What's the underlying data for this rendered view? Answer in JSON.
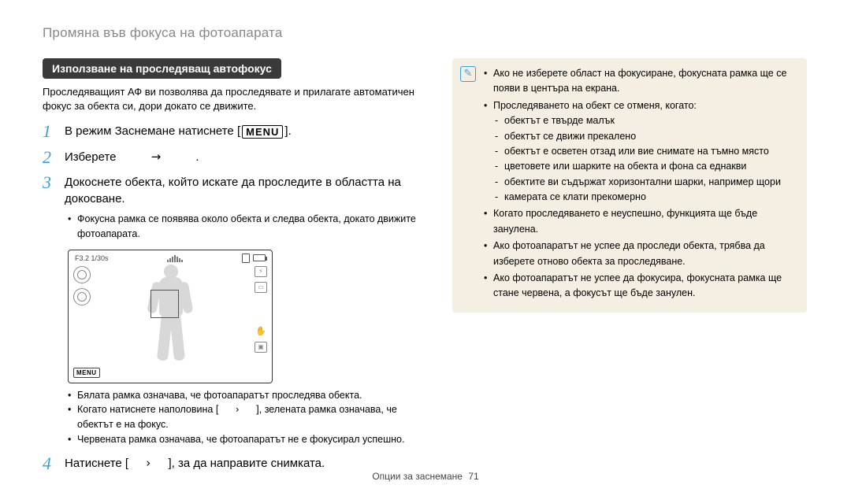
{
  "page_title": "Промяна във фокуса на фотоапарата",
  "section_head": "Използване на проследяващ автофокус",
  "intro": "Проследяващият АФ ви позволява да проследявате и прилагате автоматичен фокус за обекта си, дори докато се движите.",
  "steps": {
    "s1_num": "1",
    "s1_text_a": "В режим Заснемане натиснете [",
    "s1_menu": "MENU",
    "s1_text_b": "].",
    "s2_num": "2",
    "s2_text_a": "Изберете",
    "s2_arrow": "→",
    "s2_text_b": ".",
    "s3_num": "3",
    "s3_text": "Докоснете обекта, който искате да проследите в областта на докосване.",
    "s3_bullet": "Фокусна рамка се появява около обекта и следва обекта, докато движите фотоапарата.",
    "s4_num": "4",
    "s4_text_a": "Натиснете [",
    "s4_glyph": "›",
    "s4_text_b": "], за да направите снимката."
  },
  "preview": {
    "exposure": "F3.2  1/30s",
    "menu": "MENU"
  },
  "post_bullets": {
    "b1": "Бялата рамка означава, че фотоапаратът проследява обекта.",
    "b2_a": "Когато натиснете наполовина [",
    "b2_glyph": "›",
    "b2_b": "], зелената рамка означава, че обектът е на фокус.",
    "b3": "Червената рамка означава, че фотоапаратът не е фокусирал успешно."
  },
  "notice": {
    "n1": "Ако не изберете област на фокусиране, фокусната рамка ще се появи в центъра на екрана.",
    "n2": "Проследяването на обект се отменя, когато:",
    "n2_items": {
      "a": "обектът е твърде малък",
      "b": "обектът се движи прекалено",
      "c": "обектът е осветен отзад или вие снимате на тъмно място",
      "d": "цветовете или шарките на обекта и фона са еднакви",
      "e": "обектите ви съдържат хоризонтални шарки, например щори",
      "f": "камерата се клати прекомерно"
    },
    "n3": "Когато проследяването е неуспешно, функцията ще бъде занулена.",
    "n4": "Ако фотоапаратът не успее да проследи обекта, трябва да изберете отново обекта за проследяване.",
    "n5": "Ако фотоапаратът не успее да фокусира, фокусната рамка ще стане червена, а фокусът ще бъде занулен."
  },
  "footer": {
    "section": "Опции за заснемане",
    "page": "71"
  }
}
